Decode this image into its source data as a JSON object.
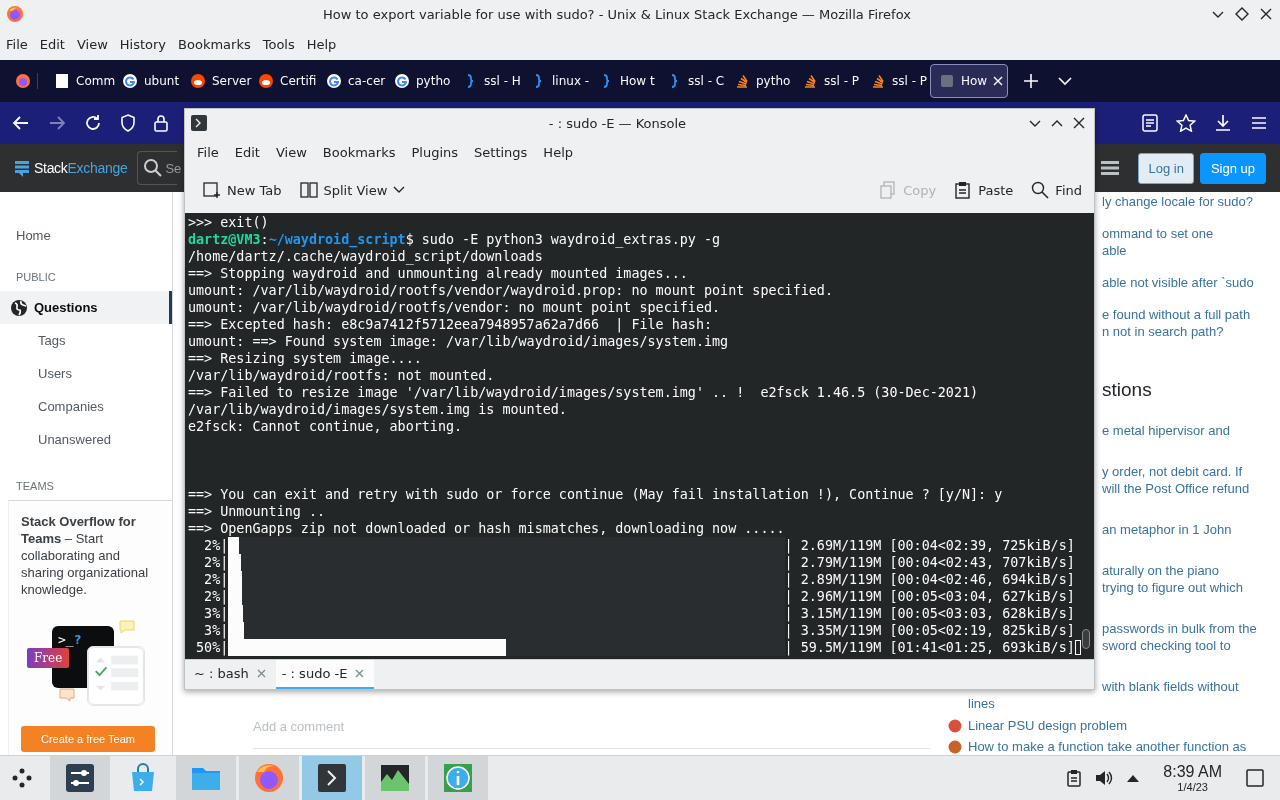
{
  "firefox": {
    "title": "How to export variable for use with sudo? - Unix & Linux Stack Exchange — Mozilla Firefox",
    "menu": [
      "File",
      "Edit",
      "View",
      "History",
      "Bookmarks",
      "Tools",
      "Help"
    ],
    "tabs": [
      {
        "label": "Comm",
        "kind": "doc",
        "selected": false
      },
      {
        "label": "ubunt",
        "kind": "google",
        "selected": false
      },
      {
        "label": "Server",
        "kind": "reddit",
        "selected": false
      },
      {
        "label": "Certifi",
        "kind": "reddit",
        "selected": false
      },
      {
        "label": "ca-cer",
        "kind": "google",
        "selected": false
      },
      {
        "label": "pytho",
        "kind": "google",
        "selected": false
      },
      {
        "label": "ssl - H",
        "kind": "brace",
        "selected": false
      },
      {
        "label": "linux -",
        "kind": "brace",
        "selected": false
      },
      {
        "label": "How t",
        "kind": "brace",
        "selected": false
      },
      {
        "label": "ssl - C",
        "kind": "brace",
        "selected": false
      },
      {
        "label": "pytho",
        "kind": "stack",
        "selected": false
      },
      {
        "label": "ssl - P",
        "kind": "stack",
        "selected": false
      },
      {
        "label": "ssl - P",
        "kind": "stack",
        "selected": false
      },
      {
        "label": "How",
        "kind": "site",
        "selected": true
      }
    ]
  },
  "site": {
    "brand": [
      "Stack",
      "Exchange"
    ],
    "search_placeholder": "Se",
    "login": "Log in",
    "signup": "Sign up",
    "home": {
      "label": "Home",
      "selected": false
    },
    "sections": [
      {
        "heading": "PUBLIC",
        "items": [
          {
            "label": "Questions",
            "kind": "main",
            "selected": true
          },
          {
            "label": "Tags",
            "kind": "sub",
            "selected": false
          },
          {
            "label": "Users",
            "kind": "sub",
            "selected": false
          },
          {
            "label": "Companies",
            "kind": "sub",
            "selected": false
          },
          {
            "label": "Unanswered",
            "kind": "sub",
            "selected": false
          }
        ]
      },
      {
        "heading": "TEAMS"
      }
    ],
    "teams_card": {
      "text": "**Stack Overflow for Teams** – Start collaborating and sharing organizational knowledge.",
      "prompt": ">_",
      "mark": "?",
      "badge": "Free",
      "button": "Create a free Team"
    },
    "comment_placeholder": "Add a comment",
    "related": [
      {
        "lines": [
          "ly change locale for sudo?"
        ],
        "kind": "clipped"
      },
      {
        "lines": [
          "ommand to set one",
          "able"
        ],
        "kind": "clipped"
      },
      {
        "lines": [
          "able not visible after `sudo"
        ],
        "kind": "clipped"
      },
      {
        "lines": [
          "e found without a full path",
          "n not in search path?"
        ],
        "kind": "clipped"
      }
    ],
    "hot_heading": "stions",
    "hot": [
      {
        "lines": [
          "e metal hipervisor and"
        ],
        "kind": "clipped"
      },
      {
        "lines": [
          "y order, not debit card. If",
          "will the Post Office refund"
        ],
        "kind": "clipped"
      },
      {
        "lines": [
          "an metaphor in 1 John"
        ],
        "kind": "clipped"
      },
      {
        "lines": [
          "aturally on the piano",
          "trying to figure out which"
        ],
        "kind": "clipped"
      },
      {
        "lines": [
          "passwords in bulk from the",
          "sword checking tool to"
        ],
        "kind": "clipped"
      },
      {
        "lines": [
          "with blank fields without",
          "lines"
        ],
        "kind": "split"
      },
      {
        "lines": [
          "Linear PSU design problem"
        ],
        "kind": "full",
        "color": "#d9503f"
      },
      {
        "lines": [
          "How to make a function take another function as"
        ],
        "kind": "full",
        "color": "#c8622a"
      }
    ]
  },
  "konsole": {
    "title": "- : sudo -E — Konsole",
    "menu": [
      "File",
      "Edit",
      "View",
      "Bookmarks",
      "Plugins",
      "Settings",
      "Help"
    ],
    "toolbar": [
      {
        "label": "New Tab",
        "kind": "newtab",
        "disabled": false
      },
      {
        "label": "Split View",
        "kind": "split",
        "disabled": false
      },
      {
        "label": "Copy",
        "kind": "copy",
        "disabled": true
      },
      {
        "label": "Paste",
        "kind": "paste",
        "disabled": false
      },
      {
        "label": "Find",
        "kind": "find",
        "disabled": false
      }
    ],
    "lines": [
      {
        "kind": "text",
        "text": ">>> exit()"
      },
      {
        "kind": "prompt",
        "user": "dartz@VM3",
        "sep": ":",
        "path": "~/waydroid_script",
        "text": "$ sudo -E python3 waydroid_extras.py -g"
      },
      {
        "kind": "text",
        "text": "/home/dartz/.cache/waydroid_script/downloads"
      },
      {
        "kind": "text",
        "text": "==> Stopping waydroid and unmounting already mounted images..."
      },
      {
        "kind": "text",
        "text": "umount: /var/lib/waydroid/rootfs/vendor/waydroid.prop: no mount point specified."
      },
      {
        "kind": "text",
        "text": "umount: /var/lib/waydroid/rootfs/vendor: no mount point specified."
      },
      {
        "kind": "text",
        "text": "==> Excepted hash: e8c9a7412f5712eea7948957a62a7d66  | File hash:"
      },
      {
        "kind": "text",
        "text": "umount: ==> Found system image: /var/lib/waydroid/images/system.img"
      },
      {
        "kind": "text",
        "text": "==> Resizing system image...."
      },
      {
        "kind": "text",
        "text": "/var/lib/waydroid/rootfs: not mounted."
      },
      {
        "kind": "text",
        "text": "==> Failed to resize image '/var/lib/waydroid/images/system.img' .. !  e2fsck 1.46.5 (30-Dec-2021)"
      },
      {
        "kind": "text",
        "text": "/var/lib/waydroid/images/system.img is mounted."
      },
      {
        "kind": "text",
        "text": "e2fsck: Cannot continue, aborting."
      },
      {
        "kind": "blank"
      },
      {
        "kind": "blank"
      },
      {
        "kind": "blank"
      },
      {
        "kind": "text",
        "text": "==> You can exit and retry with sudo or force continue (May fail installation !), Continue ? [y/N]: y"
      },
      {
        "kind": "text",
        "text": "==> Unmounting .."
      },
      {
        "kind": "text",
        "text": "==> OpenGapps zip not downloaded or hash mismatches, downloading now ....."
      },
      {
        "kind": "progress",
        "percent": "  2%|",
        "level": 0.02,
        "stats": "| 2.69M/119M [00:04<02:39, 725kiB/s]"
      },
      {
        "kind": "progress",
        "percent": "  2%|",
        "level": 0.023,
        "stats": "| 2.79M/119M [00:04<02:43, 707kiB/s]"
      },
      {
        "kind": "progress",
        "percent": "  2%|",
        "level": 0.024,
        "stats": "| 2.89M/119M [00:04<02:46, 694kiB/s]"
      },
      {
        "kind": "progress",
        "percent": "  2%|",
        "level": 0.025,
        "stats": "| 2.96M/119M [00:05<03:04, 627kiB/s]"
      },
      {
        "kind": "progress",
        "percent": "  3%|",
        "level": 0.026,
        "stats": "| 3.15M/119M [00:05<03:03, 628kiB/s]"
      },
      {
        "kind": "progress",
        "percent": "  3%|",
        "level": 0.028,
        "stats": "| 3.35M/119M [00:05<02:19, 825kiB/s]"
      },
      {
        "kind": "progress",
        "percent": " 50%|",
        "level": 0.5,
        "stats": "| 59.5M/119M [01:41<01:25, 693kiB/s]",
        "cursor": true
      }
    ],
    "tabs": [
      {
        "label": "~ : bash",
        "selected": false
      },
      {
        "label": "- : sudo -E",
        "selected": true
      }
    ]
  },
  "taskbar": {
    "apps": [
      {
        "kind": "settings",
        "running": true,
        "selected": false
      },
      {
        "kind": "store",
        "running": false,
        "selected": false
      },
      {
        "kind": "files",
        "running": true,
        "selected": false
      },
      {
        "kind": "browser",
        "running": true,
        "selected": false
      },
      {
        "kind": "terminal",
        "running": true,
        "selected": true
      },
      {
        "kind": "monitor",
        "running": true,
        "selected": false
      },
      {
        "kind": "info",
        "running": true,
        "selected": false
      }
    ],
    "time": "8:39 AM",
    "date": "1/4/23"
  }
}
